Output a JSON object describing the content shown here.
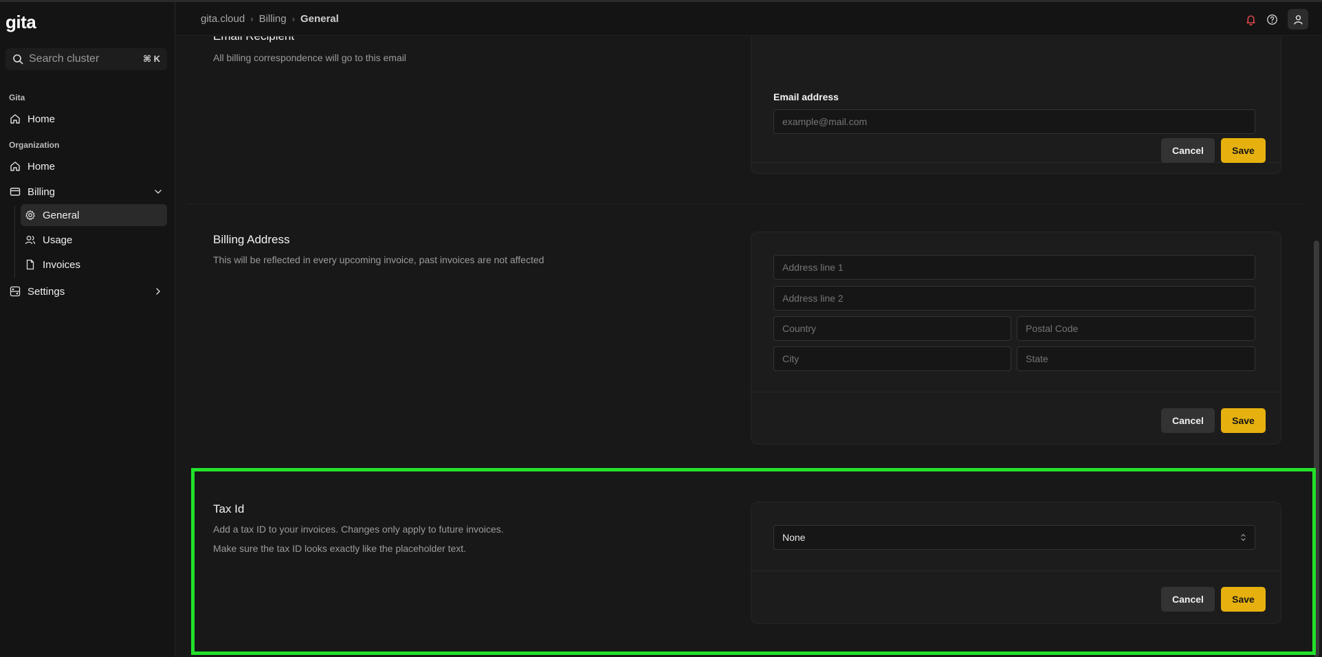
{
  "sidebar": {
    "logo": "gita",
    "search": {
      "placeholder": "Search cluster",
      "shortcut": "⌘ K"
    },
    "section_gita": "Gita",
    "gita_home": "Home",
    "section_org": "Organization",
    "org_home": "Home",
    "billing": "Billing",
    "billing_sub": [
      "General",
      "Usage",
      "Invoices"
    ],
    "settings": "Settings"
  },
  "header": {
    "breadcrumb": [
      "gita.cloud",
      "Billing",
      "General"
    ]
  },
  "email_section": {
    "title": "Email Recipient",
    "description": "All billing correspondence will go to this email",
    "field_label": "Email address",
    "placeholder": "example@mail.com",
    "cancel": "Cancel",
    "save": "Save"
  },
  "address_section": {
    "title": "Billing Address",
    "description": "This will be reflected in every upcoming invoice, past invoices are not affected",
    "fields": {
      "line1": "Address line 1",
      "line2": "Address line 2",
      "country": "Country",
      "postal": "Postal Code",
      "city": "City",
      "state": "State"
    },
    "cancel": "Cancel",
    "save": "Save"
  },
  "tax_section": {
    "title": "Tax Id",
    "description_1": "Add a tax ID to your invoices. Changes only apply to future invoices.",
    "description_2": "Make sure the tax ID looks exactly like the placeholder text.",
    "select_value": "None",
    "cancel": "Cancel",
    "save": "Save"
  },
  "colors": {
    "accent": "#e6b10f",
    "highlight": "#22e22a",
    "bell": "#e5484d"
  }
}
